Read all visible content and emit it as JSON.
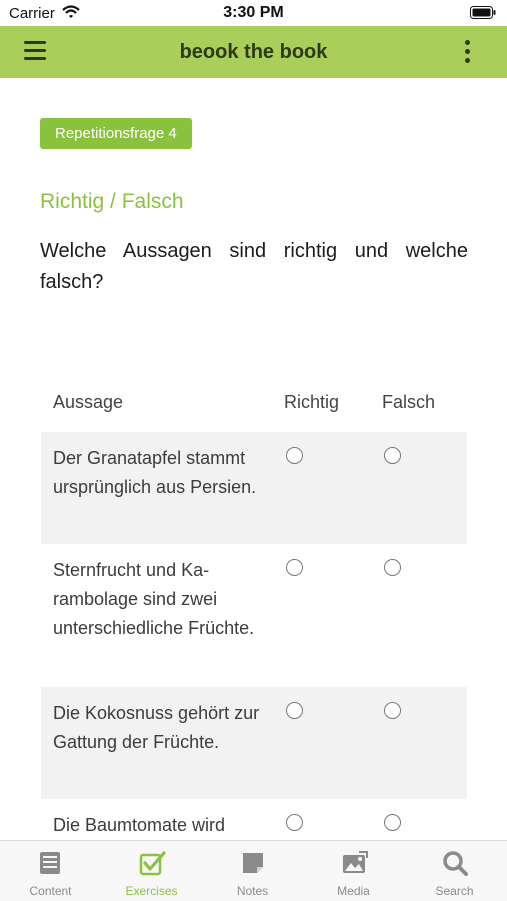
{
  "status_bar": {
    "carrier": "Carrier",
    "time": "3:30 PM"
  },
  "header": {
    "title": "beook the book"
  },
  "badge": "Repetitionsfrage 4",
  "question_type": "Richtig / Falsch",
  "question": "Welche Aussagen sind richtig und welche falsch?",
  "table": {
    "headers": {
      "statement": "Aussage",
      "true": "Richtig",
      "false": "Falsch"
    },
    "rows": [
      {
        "text": "Der Granatapfel stammt ursprünglich aus Persien."
      },
      {
        "text": "Sternfrucht und Ka­rambolage sind zwei unterschiedliche Früchte."
      },
      {
        "text": "Die Kokosnuss gehört zur Gattung der Früchte."
      },
      {
        "text": "Die Baumtomate wird"
      }
    ]
  },
  "tabs": [
    {
      "label": "Content",
      "icon": "list-icon",
      "active": false
    },
    {
      "label": "Exercises",
      "icon": "checkbox-icon",
      "active": true
    },
    {
      "label": "Notes",
      "icon": "note-icon",
      "active": false
    },
    {
      "label": "Media",
      "icon": "image-icon",
      "active": false
    },
    {
      "label": "Search",
      "icon": "search-icon",
      "active": false
    }
  ],
  "colors": {
    "accent": "#8ac13d",
    "header": "#a9cf5a",
    "header_text": "#2d3b12"
  }
}
